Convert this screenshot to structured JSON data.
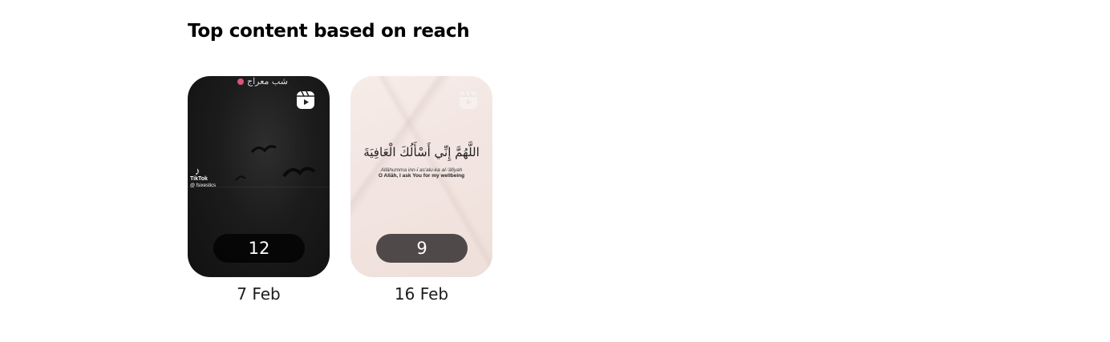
{
  "section": {
    "title": "Top content based on reach"
  },
  "cards": [
    {
      "count": "12",
      "date": "7 Feb",
      "overlay_top_text": "شب معراج",
      "watermark_brand": "TikTok",
      "watermark_handle": "@ fsixestics",
      "icon": "reel-icon"
    },
    {
      "count": "9",
      "date": "16 Feb",
      "arabic_text": "اللَّهُمَّ إِنِّي أَسْأَلُكَ الْعَافِيَةَ",
      "transliteration": "Allāhumma inn-ī as'alu-ka al-'āfiyah",
      "translation": "O Allāh, I ask You for my wellbeing",
      "icon": "reel-icon"
    }
  ],
  "colors": {
    "pill_dark": "#000000",
    "pill_grey": "#4f4a49",
    "title": "#000000"
  }
}
